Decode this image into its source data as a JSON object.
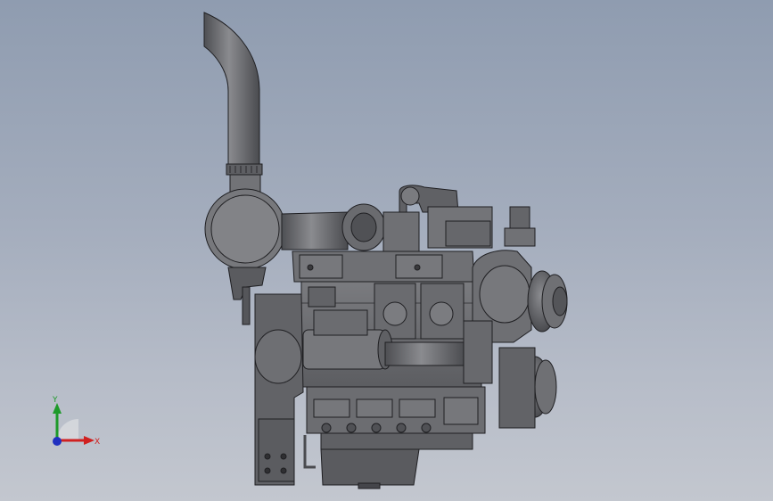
{
  "viewport": {
    "background_top": "#8f9cb0",
    "background_bottom": "#c3c7cf",
    "model_color": "#6d6e72",
    "edge_color": "#1f1f22"
  },
  "triad": {
    "x_label": "X",
    "y_label": "Y",
    "x_color": "#d02020",
    "y_color": "#1e9a2a",
    "z_color": "#2030c0"
  }
}
